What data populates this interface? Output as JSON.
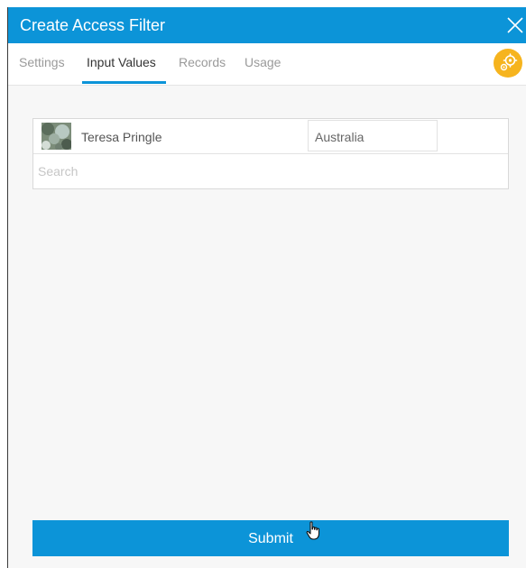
{
  "dialog": {
    "title": "Create Access Filter",
    "close_icon": "close-icon"
  },
  "tabs": [
    {
      "label": "Settings",
      "active": false
    },
    {
      "label": "Input Values",
      "active": true
    },
    {
      "label": "Records",
      "active": false
    },
    {
      "label": "Usage",
      "active": false
    }
  ],
  "settings_badge": {
    "icon": "gears-icon",
    "color": "#f6b41e"
  },
  "selection": {
    "person_name": "Teresa Pringle",
    "value": "Australia",
    "avatar_icon": "user-avatar"
  },
  "search": {
    "placeholder": "Search",
    "value": ""
  },
  "footer": {
    "submit_label": "Submit"
  },
  "colors": {
    "accent": "#0c94d8",
    "badge": "#f6b41e",
    "panel_bg": "#f7f7f7"
  }
}
